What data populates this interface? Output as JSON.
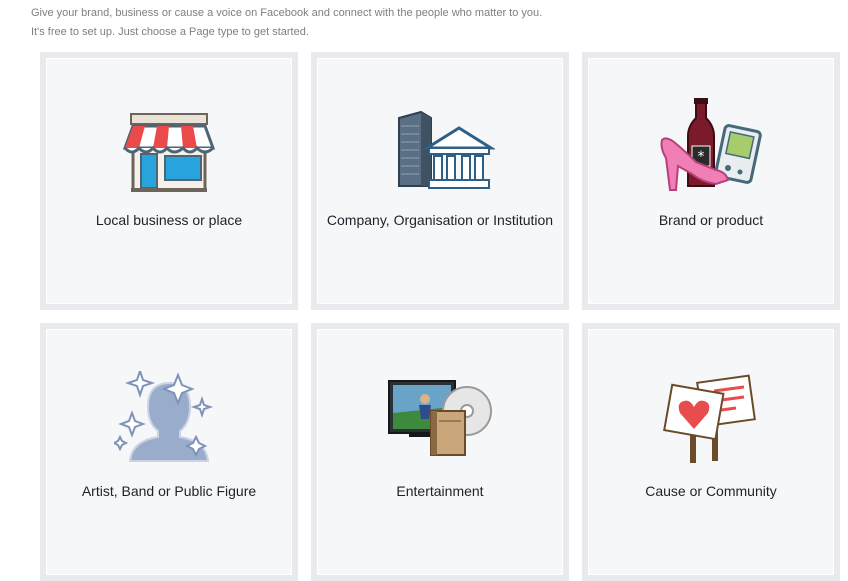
{
  "intro": {
    "line1": "Give your brand, business or cause a voice on Facebook and connect with the people who matter to you.",
    "line2": "It's free to set up. Just choose a Page type to get started."
  },
  "cards": [
    {
      "label": "Local business or place",
      "icon": "storefront-icon"
    },
    {
      "label": "Company, Organisation or Institution",
      "icon": "office-building-icon"
    },
    {
      "label": "Brand or product",
      "icon": "product-bottle-shoe-icon"
    },
    {
      "label": "Artist, Band or Public Figure",
      "icon": "person-sparkle-icon"
    },
    {
      "label": "Entertainment",
      "icon": "tv-film-icon"
    },
    {
      "label": "Cause or Community",
      "icon": "protest-signs-icon"
    }
  ],
  "colors": {
    "card_bg": "#f6f7f9",
    "card_border": "#e9eaed",
    "text": "#1d2129",
    "intro_text": "#7f7f7f"
  }
}
